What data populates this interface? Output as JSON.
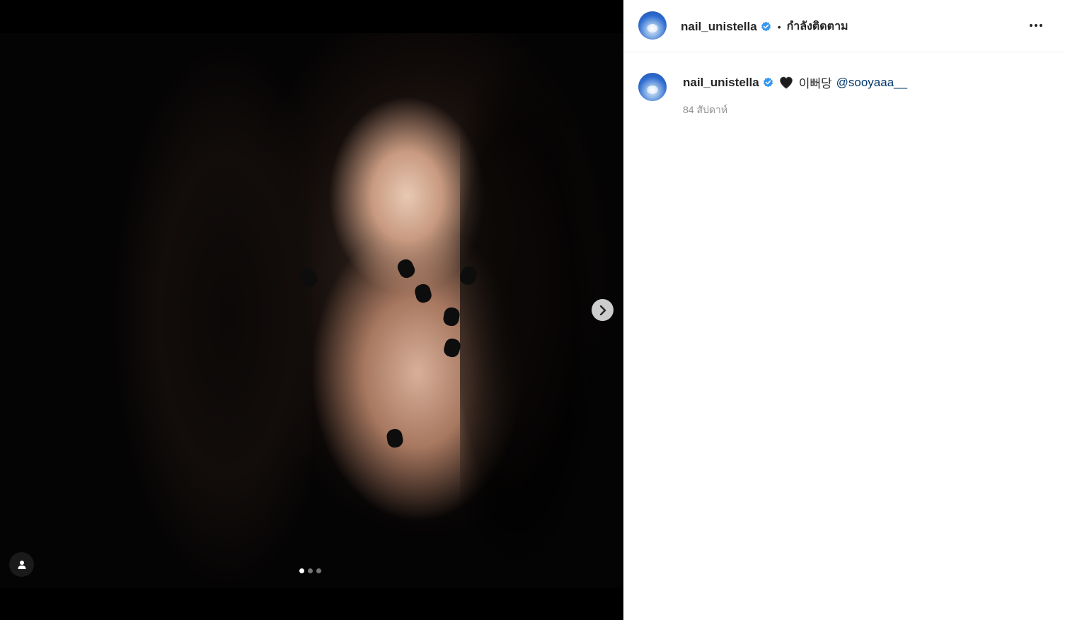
{
  "post": {
    "author": "nail_unistella",
    "follow_status": "กำลังติดตาม",
    "separator": "•"
  },
  "caption": {
    "author": "nail_unistella",
    "emoji": "black-heart",
    "text": "이뻐당",
    "mention": "@sooyaaa__",
    "timestamp": "84 สัปดาห์"
  },
  "media": {
    "carousel_count": 3,
    "active_index": 0
  },
  "colors": {
    "verified": "#3897f0",
    "mention": "#00376b",
    "muted": "#8e8e8e"
  }
}
